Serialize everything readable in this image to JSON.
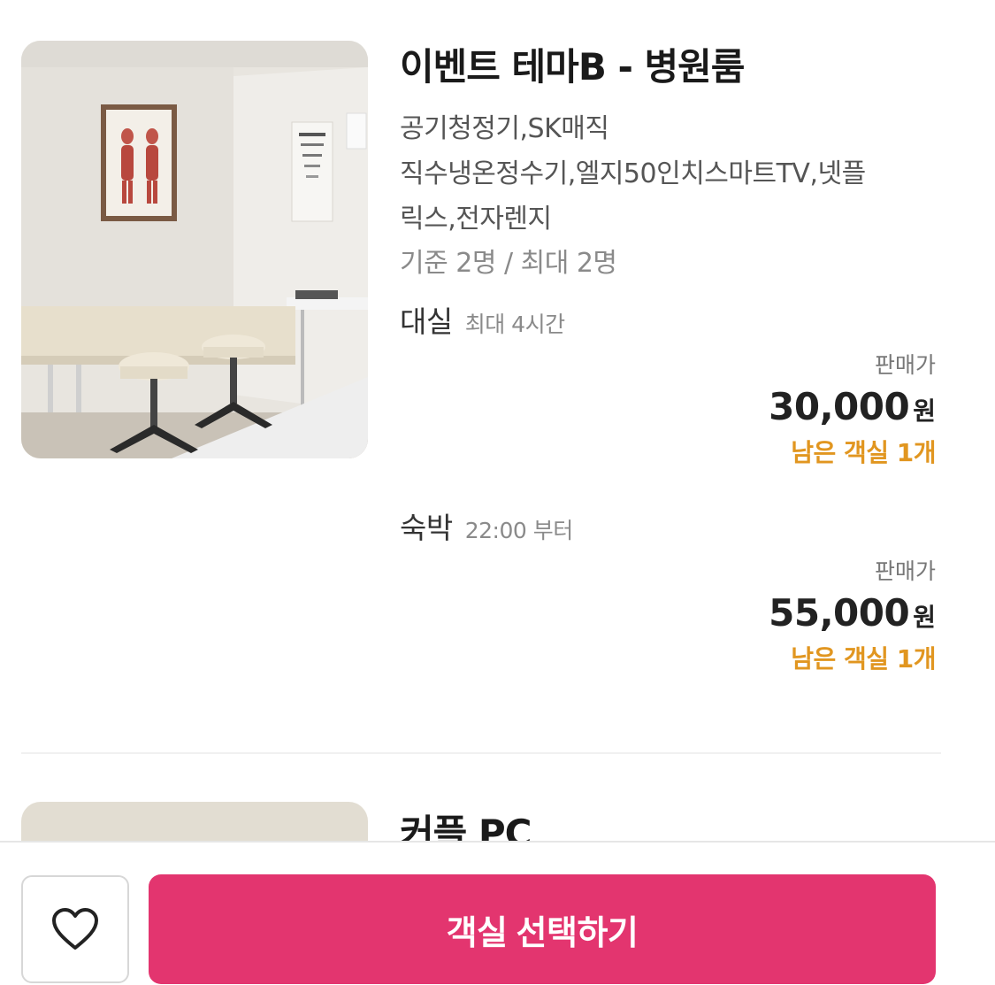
{
  "room": {
    "title": "이벤트 테마B - 병원룸",
    "amenities_lines": [
      "공기청정기,SK매직",
      "직수냉온정수기,엘지50인치스마트TV,넷플",
      "릭스,전자렌지"
    ],
    "capacity": "기준 2명 / 최대 2명",
    "options": [
      {
        "type": "대실",
        "sub": "최대 4시간",
        "price_label": "판매가",
        "price": "30,000",
        "unit": "원",
        "rooms_left": "남은 객실 1개"
      },
      {
        "type": "숙박",
        "sub": "22:00 부터",
        "price_label": "판매가",
        "price": "55,000",
        "unit": "원",
        "rooms_left": "남은 객실 1개"
      }
    ]
  },
  "next_room": {
    "title": "커플 PC"
  },
  "bottom_bar": {
    "select_label": "객실 선택하기"
  },
  "colors": {
    "accent": "#e3356f",
    "rooms_left": "#e19620"
  },
  "icons": {
    "wish": "heart-icon"
  }
}
